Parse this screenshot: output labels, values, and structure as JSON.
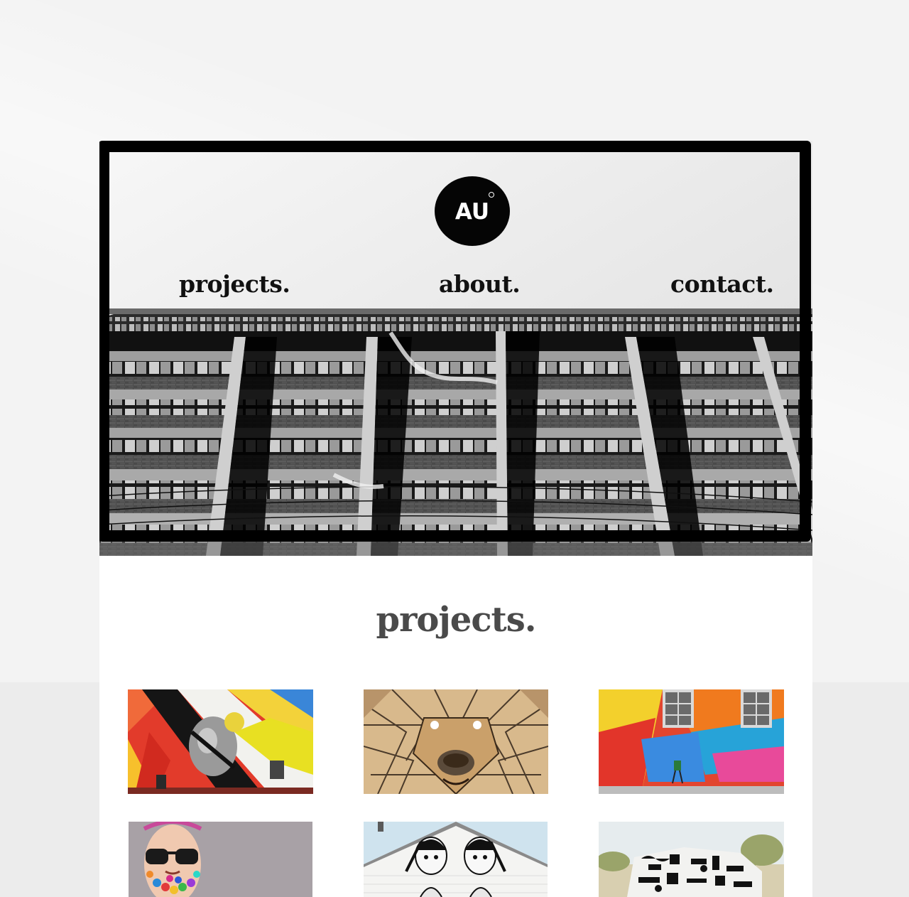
{
  "header": {
    "logo_text": "AU"
  },
  "nav": {
    "projects": "projects.",
    "about": "about.",
    "contact": "contact."
  },
  "projects_section": {
    "title": "projects."
  },
  "colors": {
    "frame": "#000000",
    "heading": "#4a4a4a",
    "background": "#f3f3f3",
    "card": "#ffffff"
  }
}
